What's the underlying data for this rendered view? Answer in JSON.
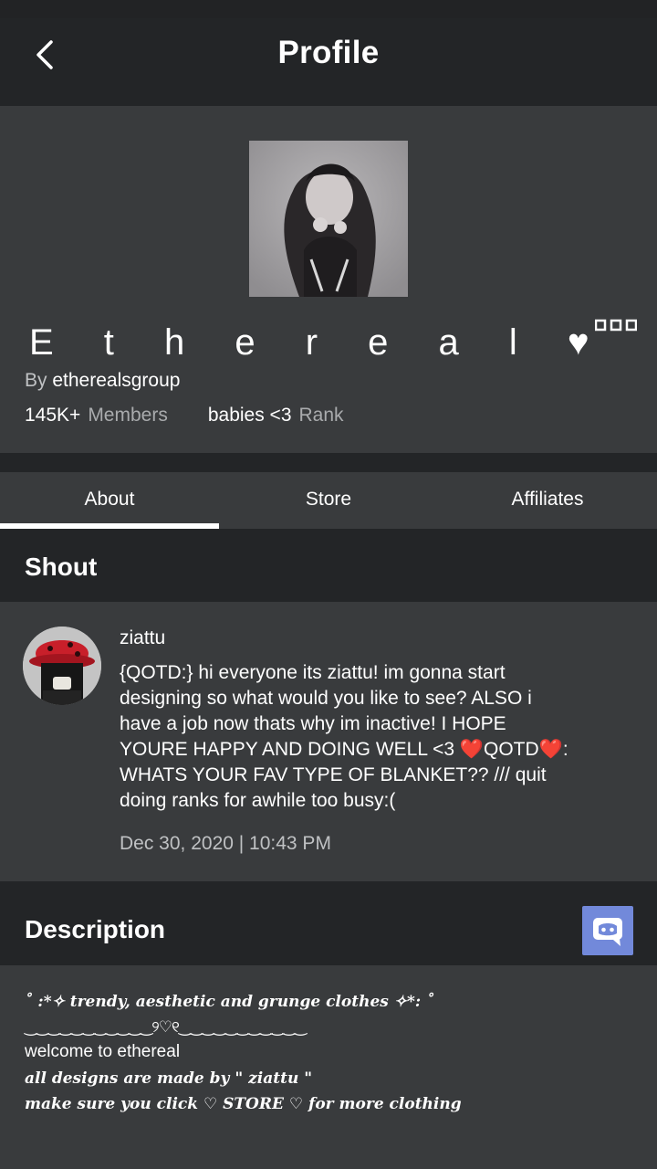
{
  "header": {
    "title": "Profile"
  },
  "group": {
    "name": "E t h e r e a l ♥",
    "by_prefix": "By",
    "owner": "etherealsgroup",
    "members_count": "145K+",
    "members_label": "Members",
    "rank_value": "babies <3",
    "rank_label": "Rank"
  },
  "tabs": [
    {
      "label": "About",
      "active": true
    },
    {
      "label": "Store",
      "active": false
    },
    {
      "label": "Affiliates",
      "active": false
    }
  ],
  "shout": {
    "section_title": "Shout",
    "poster": "ziattu",
    "lines": [
      "{QOTD:} hi everyone its ziattu! im gonna start",
      "designing so what would you like to see? ALSO i",
      "have a job now thats why im inactive! I HOPE",
      "YOURE HAPPY AND DOING WELL <3 ❤️QOTD❤️:",
      "WHATS YOUR FAV TYPE OF BLANKET?? /// quit",
      "doing ranks for awhile too busy:("
    ],
    "date": "Dec 30, 2020 | 10:43 PM"
  },
  "description": {
    "section_title": "Description",
    "lines": [
      "˚ :*✧ trendy, aesthetic and grunge clothes ✧*: ˚",
      "‿‿‿‿‿‿‿‿‿‿‿୨♡୧‿‿‿‿‿‿‿‿‿‿‿",
      "welcome to ethereal",
      "all designs are made by \" ziattu \"",
      "make sure you click ♡ STORE ♡ for more clothing"
    ]
  },
  "icons": {
    "back": "chevron-left-icon",
    "more": "more-dots-icon",
    "discord": "discord-icon"
  },
  "colors": {
    "background": "#393b3d",
    "header_bg": "#232527",
    "discord": "#7289da"
  }
}
